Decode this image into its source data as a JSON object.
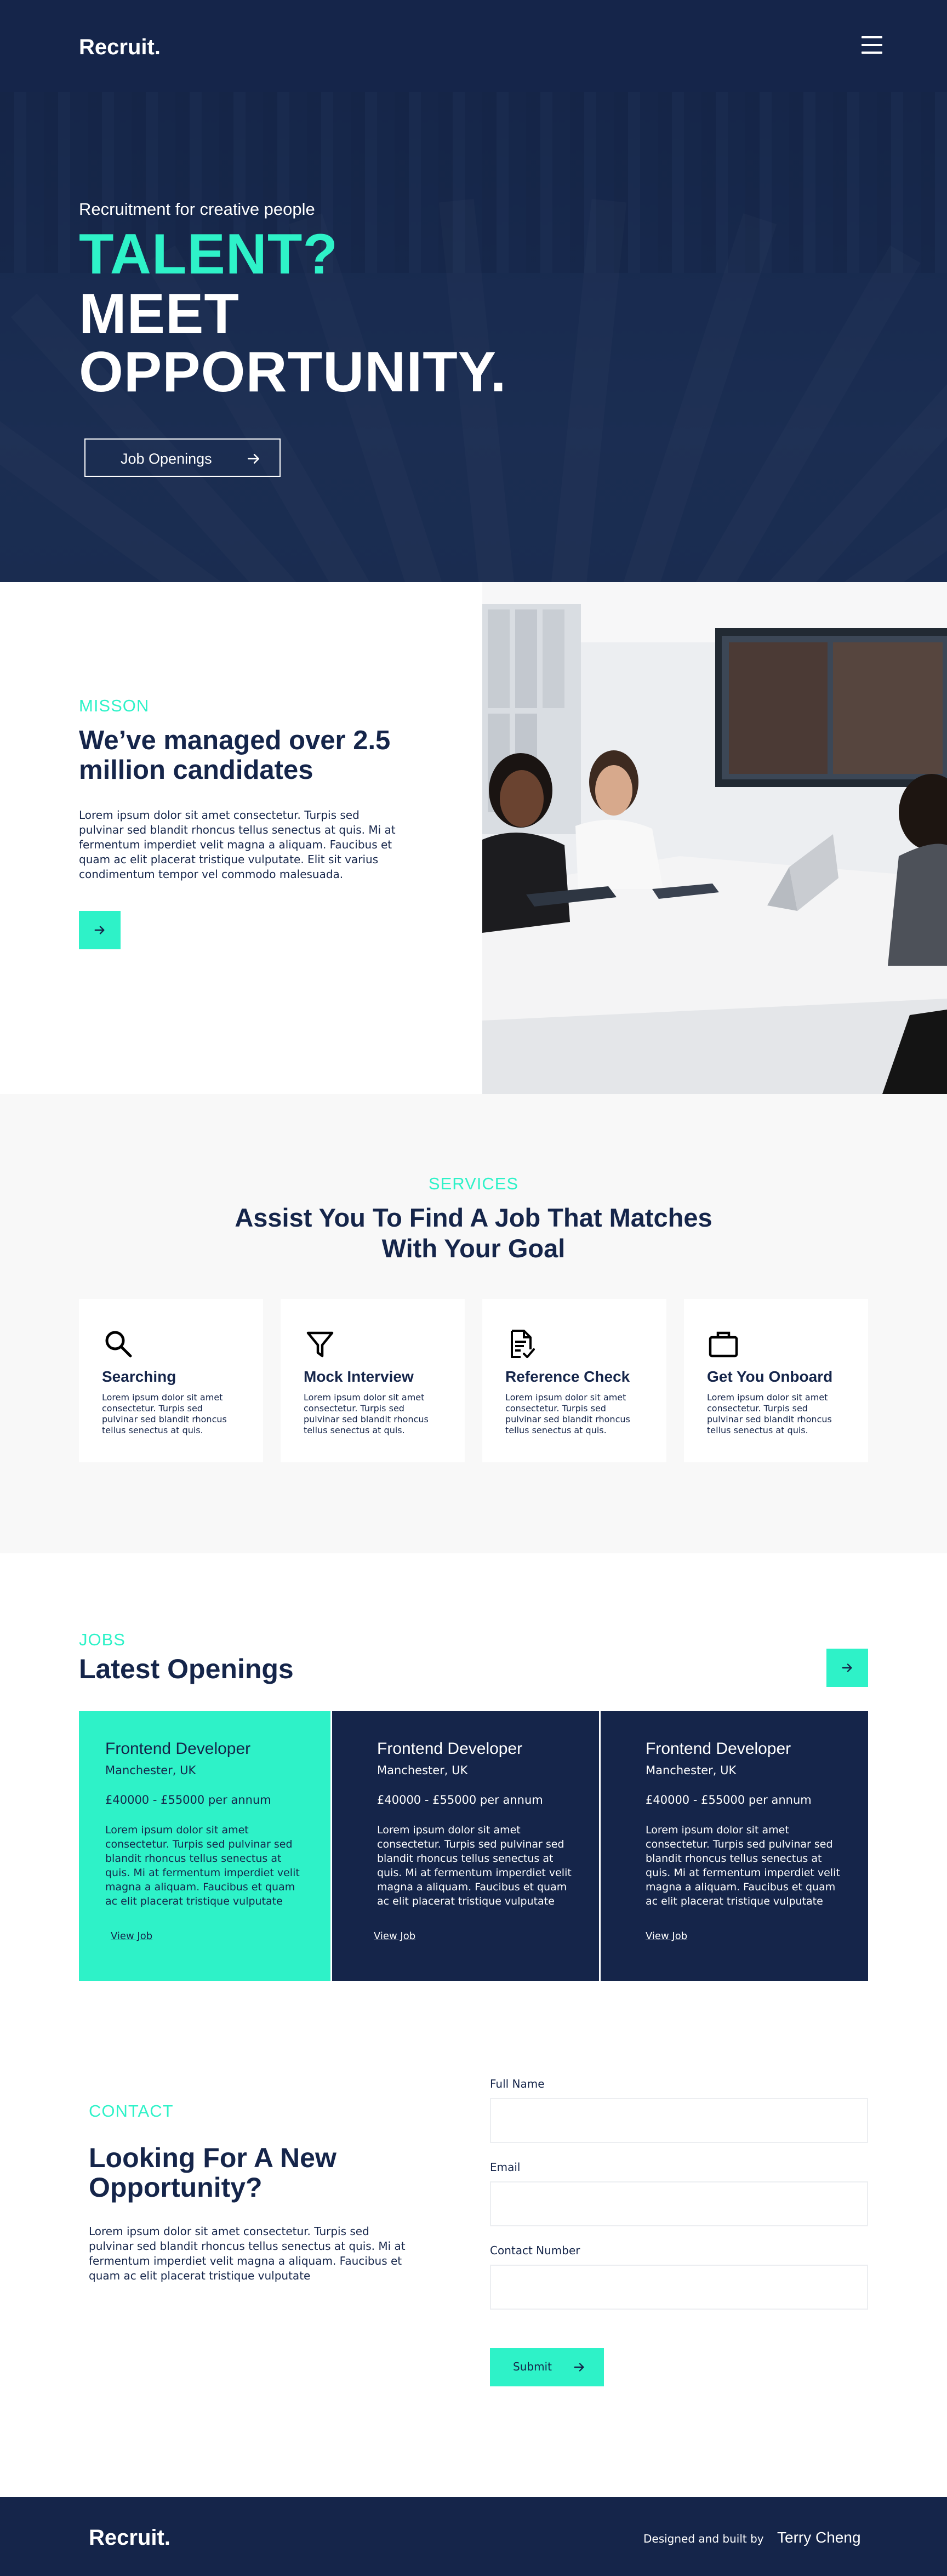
{
  "header": {
    "logo": "Recruit.",
    "menu_icon": "hamburger-menu-icon"
  },
  "hero": {
    "subtitle": "Recruitment for creative people",
    "headline_accent": "TALENT?",
    "headline_main": "MEET OPPORTUNITY.",
    "button_label": "Job Openings",
    "button_icon": "arrow-right-icon"
  },
  "mission": {
    "eyebrow": "MISSON",
    "title": "We’ve managed over 2.5 million candidates",
    "body": "Lorem ipsum dolor sit amet consectetur. Turpis sed pulvinar sed blandit rhoncus tellus senectus at quis. Mi at fermentum imperdiet velit magna a aliquam. Faucibus et quam ac elit placerat tristique vulputate. Elit sit varius condimentum tempor vel commodo malesuada.",
    "button_icon": "arrow-right-icon"
  },
  "services": {
    "eyebrow": "SERVICES",
    "title": "Assist You To Find A Job That Matches With Your Goal",
    "items": [
      {
        "title": "Searching",
        "icon": "search-icon",
        "body": "Lorem ipsum dolor sit amet consectetur. Turpis sed pulvinar sed blandit rhoncus tellus senectus at quis."
      },
      {
        "title": "Mock Interview",
        "icon": "filter-icon",
        "body": "Lorem ipsum dolor sit amet consectetur. Turpis sed pulvinar sed blandit rhoncus tellus senectus at quis."
      },
      {
        "title": "Reference Check",
        "icon": "document-check-icon",
        "body": "Lorem ipsum dolor sit amet consectetur. Turpis sed pulvinar sed blandit rhoncus tellus senectus at quis."
      },
      {
        "title": "Get You Onboard",
        "icon": "briefcase-icon",
        "body": "Lorem ipsum dolor sit amet consectetur. Turpis sed pulvinar sed blandit rhoncus tellus senectus at quis."
      }
    ]
  },
  "jobs": {
    "eyebrow": "JOBS",
    "title": "Latest Openings",
    "button_icon": "arrow-right-icon",
    "items": [
      {
        "title": "Frontend Developer",
        "location": "Manchester, UK",
        "salary": "£40000 - £55000 per annum",
        "body": "Lorem ipsum dolor sit amet consectetur. Turpis sed pulvinar sed blandit rhoncus tellus senectus at quis. Mi at fermentum imperdiet velit magna a aliquam. Faucibus et quam ac elit placerat tristique vulputate",
        "link": "View Job"
      },
      {
        "title": "Frontend Developer",
        "location": "Manchester, UK",
        "salary": "£40000 - £55000 per annum",
        "body": "Lorem ipsum dolor sit amet consectetur. Turpis sed pulvinar sed blandit rhoncus tellus senectus at quis. Mi at fermentum imperdiet velit magna a aliquam. Faucibus et quam ac elit placerat tristique vulputate",
        "link": "View Job"
      },
      {
        "title": "Frontend Developer",
        "location": "Manchester, UK",
        "salary": "£40000 - £55000 per annum",
        "body": "Lorem ipsum dolor sit amet consectetur. Turpis sed pulvinar sed blandit rhoncus tellus senectus at quis. Mi at fermentum imperdiet velit magna a aliquam. Faucibus et quam ac elit placerat tristique vulputate",
        "link": "View Job"
      }
    ]
  },
  "contact": {
    "eyebrow": "CONTACT",
    "title": "Looking For A New Opportunity?",
    "body": "Lorem ipsum dolor sit amet consectetur. Turpis sed pulvinar sed blandit rhoncus tellus senectus at quis. Mi at fermentum imperdiet velit magna a aliquam. Faucibus et quam ac elit placerat tristique vulputate",
    "form": {
      "full_name_label": "Full Name",
      "full_name_value": "",
      "email_label": "Email",
      "email_value": "",
      "phone_label": "Contact Number",
      "phone_value": "",
      "submit_label": "Submit",
      "submit_icon": "arrow-right-icon"
    }
  },
  "footer": {
    "logo": "Recruit.",
    "credit": "Designed and built by",
    "author": "Terry Cheng"
  },
  "colors": {
    "navy": "#15254a",
    "accent": "#2ef2c8",
    "light_bg": "#f8f8f8",
    "white": "#ffffff"
  }
}
